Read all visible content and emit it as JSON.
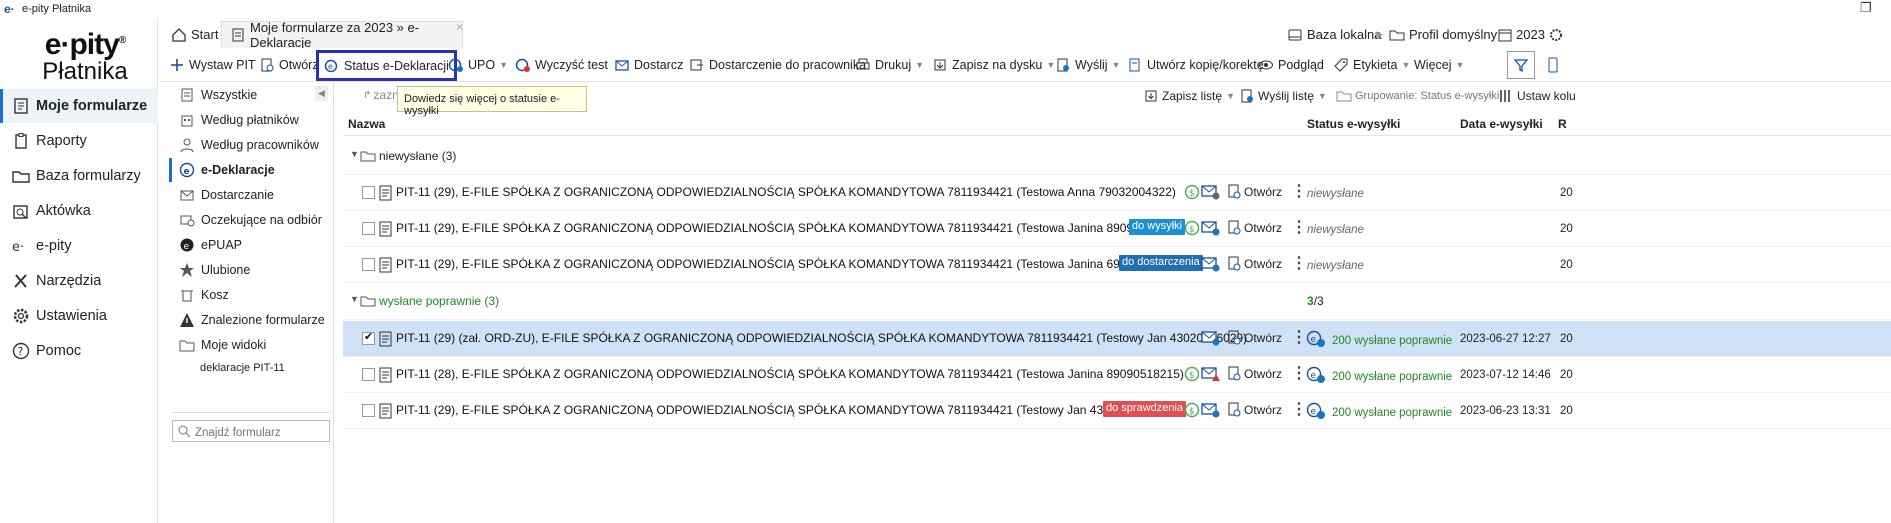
{
  "window": {
    "logo": "e·",
    "title": "e-pity Płatnika",
    "restore": "❐"
  },
  "brand": {
    "line1": "e·pity",
    "reg": "®",
    "line2": "Płatnika"
  },
  "sidebar": {
    "items": [
      {
        "label": "Moje formularze",
        "icon": "forms-icon"
      },
      {
        "label": "Raporty",
        "icon": "clipboard-icon"
      },
      {
        "label": "Baza formularzy",
        "icon": "folder-icon"
      },
      {
        "label": "Aktówka",
        "icon": "briefcase-icon"
      },
      {
        "label": "e-pity",
        "icon": "epity-icon"
      },
      {
        "label": "Narzędzia",
        "icon": "tools-icon"
      },
      {
        "label": "Ustawienia",
        "icon": "gear-icon"
      },
      {
        "label": "Pomoc",
        "icon": "help-icon"
      }
    ]
  },
  "tabs": {
    "start": "Start",
    "current": "Moje formularze za 2023 » e-Deklaracje",
    "close": "×"
  },
  "top_right": {
    "db": "Baza lokalna",
    "sep": "▶",
    "profile": "Profil domyślny",
    "year": "2023"
  },
  "toolbar": {
    "wystaw": "Wystaw PIT",
    "otworz": "Otwórz",
    "status": "Status e-Deklaracji",
    "upo": "UPO",
    "wyczysc": "Wyczyść test",
    "dostarcz": "Dostarcz",
    "dostarczenie": "Dostarczenie do pracownika",
    "drukuj": "Drukuj",
    "zapisz": "Zapisz na dysku",
    "wyslij": "Wyślij",
    "utworz": "Utwórz kopię/korektę",
    "podglad": "Podgląd",
    "etykieta": "Etykieta",
    "wiecej": "Więcej",
    "caret": "▼"
  },
  "tooltip": "Dowiedz się więcej o statusie e-wysyłki",
  "panel": {
    "collapse": "◀",
    "items": [
      {
        "label": "Wszystkie"
      },
      {
        "label": "Według płatników"
      },
      {
        "label": "Według pracowników"
      },
      {
        "label": "e-Deklaracje"
      },
      {
        "label": "Dostarczanie"
      },
      {
        "label": "Oczekujące na odbiór"
      },
      {
        "label": "ePUAP"
      },
      {
        "label": "Ulubione"
      },
      {
        "label": "Kosz"
      },
      {
        "label": "Znalezione formularze"
      },
      {
        "label": "Moje widoki"
      },
      {
        "label": "deklaracje PIT-11"
      }
    ],
    "search_placeholder": "Znajdź formularz"
  },
  "gridtools": {
    "zazn": "zazn",
    "zapisz_liste": "Zapisz listę",
    "wyslij_liste": "Wyślij listę",
    "grupowanie": "Grupowanie: Status e-wysyłki",
    "ustaw": "Ustaw kolu"
  },
  "columns": {
    "name": "Nazwa",
    "status": "Status e-wysyłki",
    "date": "Data e-wysyłki",
    "r": "R"
  },
  "groups": [
    {
      "label": "niewysłane (3)",
      "count": "",
      "rows": [
        {
          "name": "PIT-11 (29), E-FILE SPÓŁKA Z OGRANICZONĄ ODPOWIEDZIALNOŚCIĄ SPÓŁKA KOMANDYTOWA 7811934421 (Testowa Anna 79032004322)",
          "badge": "",
          "status": "niewysłane",
          "date": "",
          "r": "20"
        },
        {
          "name": "PIT-11 (29), E-FILE SPÓŁKA Z OGRANICZONĄ ODPOWIEDZIALNOŚCIĄ SPÓŁKA KOMANDYTOWA 7811934421 (Testowa Janina 89090518215)",
          "badge": "do wysyłki",
          "status": "niewysłane",
          "date": "",
          "r": "20"
        },
        {
          "name": "PIT-11 (29), E-FILE SPÓŁKA Z OGRANICZONĄ ODPOWIEDZIALNOŚCIĄ SPÓŁKA KOMANDYTOWA 7811934421 (Testowa Janina 69052265311)",
          "badge": "do dostarczenia",
          "status": "niewysłane",
          "date": "",
          "r": "20"
        }
      ]
    },
    {
      "label": "wysłane poprawnie (3)",
      "count_bold": "3",
      "count_rest": "/3",
      "rows": [
        {
          "name": "PIT-11 (29) (zał. ORD-ZU), E-FILE SPÓŁKA Z OGRANICZONĄ ODPOWIEDZIALNOŚCIĄ SPÓŁKA KOMANDYTOWA 7811934421 (Testowy Jan 43020776029)",
          "badge": "",
          "status": "200 wysłane poprawnie",
          "date": "2023-06-27 12:27",
          "r": "20"
        },
        {
          "name": "PIT-11 (28), E-FILE SPÓŁKA Z OGRANICZONĄ ODPOWIEDZIALNOŚCIĄ SPÓŁKA KOMANDYTOWA 7811934421 (Testowa Janina 89090518215)",
          "badge": "",
          "status": "200 wysłane poprawnie",
          "date": "2023-07-12 14:46",
          "r": "20"
        },
        {
          "name": "PIT-11 (29), E-FILE SPÓŁKA Z OGRANICZONĄ ODPOWIEDZIALNOŚCIĄ SPÓŁKA KOMANDYTOWA 7811934421 (Testowy Jan 43020776029)",
          "badge": "do sprawdzenia",
          "status": "200 wysłane poprawnie",
          "date": "2023-06-23 13:31",
          "r": "20"
        }
      ]
    }
  ],
  "row_action": "Otwórz",
  "row_menu": "⋮",
  "colors": {
    "accent": "#1a73c8",
    "highlight": "#2d2fb9",
    "ok": "#1f8a1f",
    "badge_blue": "#1e8fd4",
    "badge_red": "#e05050"
  }
}
